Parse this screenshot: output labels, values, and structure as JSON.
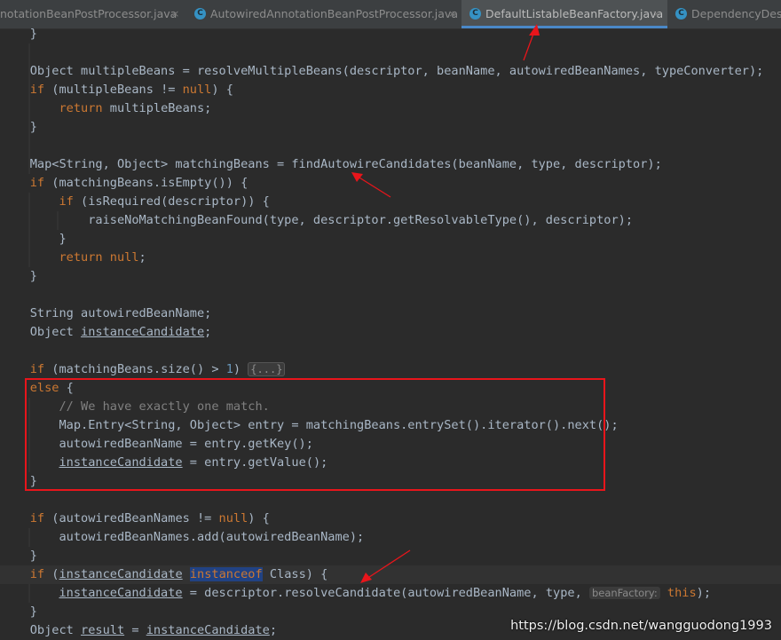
{
  "editor_tabs": [
    {
      "label": "notationBeanPostProcessor.java",
      "icon": "",
      "active": false,
      "close": "×"
    },
    {
      "label": "AutowiredAnnotationBeanPostProcessor.java",
      "icon": "c-class-icon",
      "active": false,
      "close": "×"
    },
    {
      "label": "DefaultListableBeanFactory.java",
      "icon": "c-class-icon",
      "active": true,
      "close": "×"
    },
    {
      "label": "DependencyDesc",
      "icon": "c-class-icon",
      "active": false,
      "close": ""
    }
  ],
  "code_lines": [
    [
      {
        "t": "    }"
      }
    ],
    [],
    [
      {
        "t": "    Object multipleBeans = resolveMultipleBeans(descriptor, beanName, autowiredBeanNames, typeConverter);"
      }
    ],
    [
      {
        "t": "    "
      },
      {
        "t": "if",
        "c": "kw"
      },
      {
        "t": " (multipleBeans != "
      },
      {
        "t": "null",
        "c": "kw"
      },
      {
        "t": ") {"
      }
    ],
    [
      {
        "t": "        "
      },
      {
        "t": "return",
        "c": "kw"
      },
      {
        "t": " multipleBeans;"
      }
    ],
    [
      {
        "t": "    }"
      }
    ],
    [],
    [
      {
        "t": "    Map<String, Object> matchingBeans = findAutowireCandidates(beanName, type, descriptor);"
      }
    ],
    [
      {
        "t": "    "
      },
      {
        "t": "if",
        "c": "kw"
      },
      {
        "t": " (matchingBeans.isEmpty()) {"
      }
    ],
    [
      {
        "t": "        "
      },
      {
        "t": "if",
        "c": "kw"
      },
      {
        "t": " (isRequired(descriptor)) {"
      }
    ],
    [
      {
        "t": "            raiseNoMatchingBeanFound(type, descriptor.getResolvableType(), descriptor);"
      }
    ],
    [
      {
        "t": "        }"
      }
    ],
    [
      {
        "t": "        "
      },
      {
        "t": "return",
        "c": "kw"
      },
      {
        "t": " "
      },
      {
        "t": "null",
        "c": "kw"
      },
      {
        "t": ";"
      }
    ],
    [
      {
        "t": "    }"
      }
    ],
    [],
    [
      {
        "t": "    String autowiredBeanName;"
      }
    ],
    [
      {
        "t": "    Object "
      },
      {
        "t": "instanceCandidate",
        "c": "fld"
      },
      {
        "t": ";"
      }
    ],
    [],
    [
      {
        "t": "    "
      },
      {
        "t": "if",
        "c": "kw"
      },
      {
        "t": " (matchingBeans.size() > "
      },
      {
        "t": "1",
        "c": "num"
      },
      {
        "t": ") "
      },
      {
        "t": "{...}",
        "c": "fold"
      }
    ],
    [
      {
        "t": "    "
      },
      {
        "t": "else",
        "c": "kw"
      },
      {
        "t": " {"
      }
    ],
    [
      {
        "t": "        "
      },
      {
        "t": "// We have exactly one match.",
        "c": "cmt"
      }
    ],
    [
      {
        "t": "        Map.Entry<String, Object> entry = matchingBeans.entrySet().iterator().next();"
      }
    ],
    [
      {
        "t": "        autowiredBeanName = entry.getKey();"
      }
    ],
    [
      {
        "t": "        "
      },
      {
        "t": "instanceCandidate",
        "c": "fld"
      },
      {
        "t": " = entry.getValue();"
      }
    ],
    [
      {
        "t": "    }"
      }
    ],
    [],
    [
      {
        "t": "    "
      },
      {
        "t": "if",
        "c": "kw"
      },
      {
        "t": " (autowiredBeanNames != "
      },
      {
        "t": "null",
        "c": "kw"
      },
      {
        "t": ") {"
      }
    ],
    [
      {
        "t": "        autowiredBeanNames.add(autowiredBeanName);"
      }
    ],
    [
      {
        "t": "    }"
      }
    ],
    [
      {
        "t": "    "
      },
      {
        "t": "if",
        "c": "kw"
      },
      {
        "t": " ("
      },
      {
        "t": "instanceCandidate",
        "c": "fld"
      },
      {
        "t": " "
      },
      {
        "t": "instanceof",
        "c": "hl"
      },
      {
        "t": " Class) {"
      }
    ],
    [
      {
        "t": "        "
      },
      {
        "t": "instanceCandidate",
        "c": "fld"
      },
      {
        "t": " = descriptor.resolveCandidate(autowiredBeanName, type, "
      },
      {
        "t": "beanFactory:",
        "c": "hint"
      },
      {
        "t": " "
      },
      {
        "t": "this",
        "c": "kw"
      },
      {
        "t": ");"
      }
    ],
    [
      {
        "t": "    }"
      }
    ],
    [
      {
        "t": "    Object "
      },
      {
        "t": "result",
        "c": "fld"
      },
      {
        "t": " = "
      },
      {
        "t": "instanceCandidate",
        "c": "fld"
      },
      {
        "t": ";"
      }
    ]
  ],
  "current_line_index": 29,
  "watermark": "https://blog.csdn.net/wangguodong1993",
  "colors": {
    "background": "#2b2b2b",
    "keyword": "#cc7832",
    "text": "#a9b7c6",
    "comment": "#808080",
    "number": "#6897bb",
    "annotation_red": "#e8151b",
    "active_tab_underline": "#4a88c7"
  }
}
